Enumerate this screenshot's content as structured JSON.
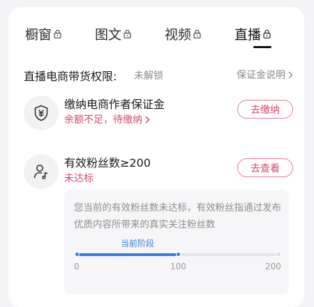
{
  "tabs": [
    {
      "label": "橱窗",
      "locked": true
    },
    {
      "label": "图文",
      "locked": true
    },
    {
      "label": "视频",
      "locked": true
    },
    {
      "label": "直播",
      "locked": true,
      "active": true
    }
  ],
  "permission": {
    "title": "直播电商带货权限:",
    "status": "未解锁",
    "deposit_link": "保证金说明"
  },
  "requirements": [
    {
      "icon": "yuan-shield-icon",
      "title": "缴纳电商作者保证金",
      "subtitle": "余额不足，待缴纳",
      "button": "去缴纳"
    },
    {
      "icon": "user-music-icon",
      "title": "有效粉丝数≥200",
      "subtitle": "未达标",
      "button": "去查看"
    }
  ],
  "info": {
    "text": "您当前的有效粉丝数未达标，有效粉丝指通过发布优质内容所带来的真实关注粉丝数",
    "tooltip": "当前阶段",
    "progress_fraction": 0.5,
    "ticks": [
      "0",
      "100",
      "200"
    ]
  },
  "colors": {
    "accent_pink": "#d64a6c",
    "progress_blue": "#3b7be0"
  }
}
